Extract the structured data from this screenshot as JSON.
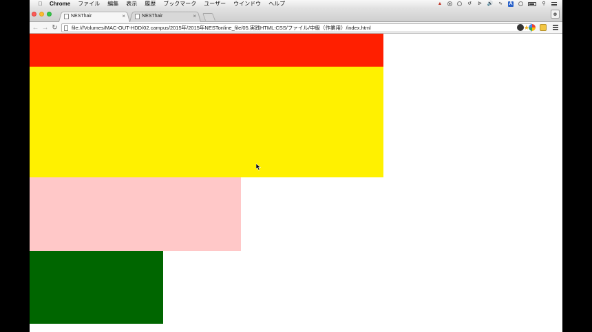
{
  "menubar": {
    "app_name": "Chrome",
    "items": [
      "ファイル",
      "編集",
      "表示",
      "履歴",
      "ブックマーク",
      "ユーザー",
      "ウインドウ",
      "ヘルプ"
    ]
  },
  "browser": {
    "tabs": [
      {
        "title": "NESThair",
        "active": true
      },
      {
        "title": "NESThair",
        "active": false
      }
    ],
    "address": "file:///Volumes/MAC-OUT-HDD/02.campus/2015年/2015年NESTonline_file/05.実践HTML:CSS/ファイル/中級（作業用）/index.html"
  },
  "page": {
    "blocks": [
      {
        "name": "red-block",
        "color": "#ff1f00"
      },
      {
        "name": "yellow-block",
        "color": "#fff100"
      },
      {
        "name": "pink-block",
        "color": "#ffc8c8"
      },
      {
        "name": "green-block",
        "color": "#006600"
      }
    ]
  }
}
